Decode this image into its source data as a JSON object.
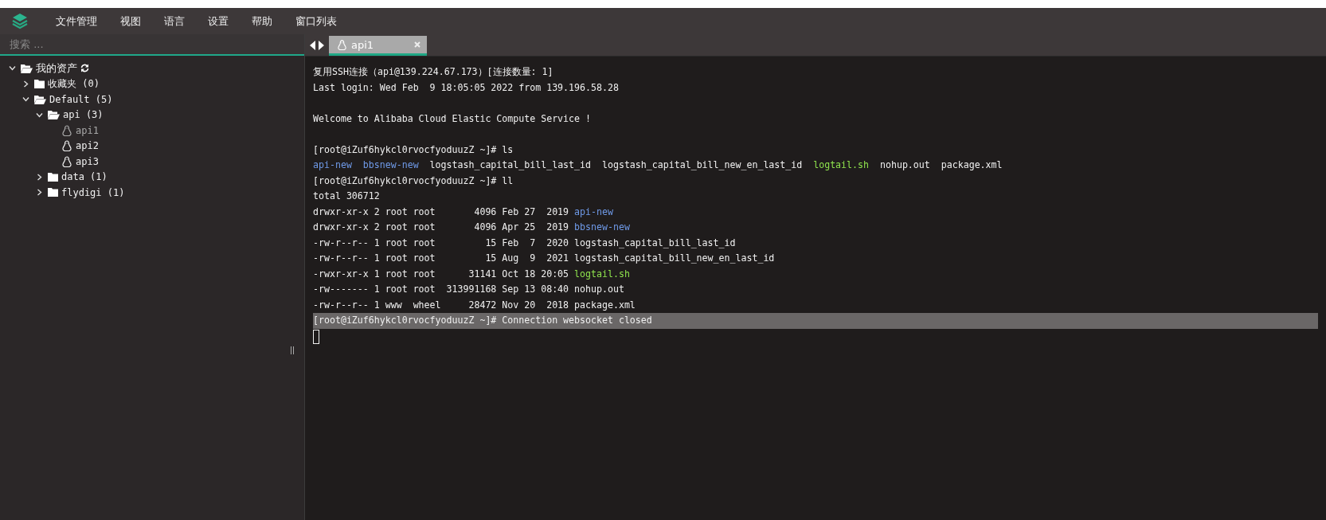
{
  "menu": [
    "文件管理",
    "视图",
    "语言",
    "设置",
    "帮助",
    "窗口列表"
  ],
  "search": {
    "placeholder": "搜索 ..."
  },
  "tree": {
    "label": "我的资产",
    "expanded": true,
    "children": [
      {
        "label": "收藏夹 (0)",
        "kind": "folder",
        "expanded": false
      },
      {
        "label": "Default (5)",
        "kind": "folder",
        "expanded": true,
        "children": [
          {
            "label": "api (3)",
            "kind": "folder",
            "expanded": true,
            "children": [
              {
                "label": "api1",
                "kind": "host",
                "selected": true
              },
              {
                "label": "api2",
                "kind": "host",
                "selected": false
              },
              {
                "label": "api3",
                "kind": "host",
                "selected": false
              }
            ]
          },
          {
            "label": "data (1)",
            "kind": "folder",
            "expanded": false
          },
          {
            "label": "flydigi (1)",
            "kind": "folder",
            "expanded": false
          }
        ]
      }
    ]
  },
  "tabs": [
    {
      "label": "api1",
      "selected": true
    }
  ],
  "terminal": {
    "lines": [
      {
        "kind": "text",
        "highlighted": false,
        "segments": [
          {
            "kind": "plain",
            "text": "复用SSH连接（api@139.224.67.173）[连接数量: 1]"
          }
        ]
      },
      {
        "kind": "text",
        "highlighted": false,
        "segments": [
          {
            "kind": "plain",
            "text": "Last login: Wed Feb  9 18:05:05 2022 from 139.196.58.28"
          }
        ]
      },
      {
        "kind": "blank",
        "highlighted": false
      },
      {
        "kind": "text",
        "highlighted": false,
        "segments": [
          {
            "kind": "plain",
            "text": "Welcome to Alibaba Cloud Elastic Compute Service !"
          }
        ]
      },
      {
        "kind": "blank",
        "highlighted": false
      },
      {
        "kind": "text",
        "highlighted": false,
        "segments": [
          {
            "kind": "plain",
            "text": "[root@iZuf6hykcl0rvocfyoduuzZ ~]# ls"
          }
        ]
      },
      {
        "kind": "listing",
        "highlighted": false,
        "segments": [
          {
            "kind": "dir",
            "text": "api-new"
          },
          {
            "kind": "dir",
            "text": "bbsnew-new"
          },
          {
            "kind": "plain",
            "text": "logstash_capital_bill_last_id"
          },
          {
            "kind": "plain",
            "text": "logstash_capital_bill_new_en_last_id"
          },
          {
            "kind": "exec",
            "text": "logtail.sh"
          },
          {
            "kind": "plain",
            "text": "nohup.out"
          },
          {
            "kind": "plain",
            "text": "package.xml"
          }
        ]
      },
      {
        "kind": "text",
        "highlighted": false,
        "segments": [
          {
            "kind": "plain",
            "text": "[root@iZuf6hykcl0rvocfyoduuzZ ~]# ll"
          }
        ]
      },
      {
        "kind": "text",
        "highlighted": false,
        "segments": [
          {
            "kind": "plain",
            "text": "total 306712"
          }
        ]
      },
      {
        "kind": "text",
        "highlighted": false,
        "segments": [
          {
            "kind": "plain",
            "text": "drwxr-xr-x 2 root root       4096 Feb 27  2019"
          },
          {
            "kind": "dir",
            "text": "api-new"
          }
        ]
      },
      {
        "kind": "text",
        "highlighted": false,
        "segments": [
          {
            "kind": "plain",
            "text": "drwxr-xr-x 2 root root       4096 Apr 25  2019"
          },
          {
            "kind": "dir",
            "text": "bbsnew-new"
          }
        ]
      },
      {
        "kind": "text",
        "highlighted": false,
        "segments": [
          {
            "kind": "plain",
            "text": "-rw-r--r-- 1 root root         15 Feb  7  2020 logstash_capital_bill_last_id"
          }
        ]
      },
      {
        "kind": "text",
        "highlighted": false,
        "segments": [
          {
            "kind": "plain",
            "text": "-rw-r--r-- 1 root root         15 Aug  9  2021 logstash_capital_bill_new_en_last_id"
          }
        ]
      },
      {
        "kind": "text",
        "highlighted": false,
        "segments": [
          {
            "kind": "plain",
            "text": "-rwxr-xr-x 1 root root      31141 Oct 18 20:05"
          },
          {
            "kind": "exec",
            "text": "logtail.sh"
          }
        ]
      },
      {
        "kind": "text",
        "highlighted": false,
        "segments": [
          {
            "kind": "plain",
            "text": "-rw------- 1 root root  313991168 Sep 13 08:40 nohup.out"
          }
        ]
      },
      {
        "kind": "text",
        "highlighted": false,
        "segments": [
          {
            "kind": "plain",
            "text": "-rw-r--r-- 1 www  wheel     28472 Nov 20  2018 package.xml"
          }
        ]
      },
      {
        "kind": "text",
        "highlighted": true,
        "segments": [
          {
            "kind": "plain",
            "text": "[root@iZuf6hykcl0rvocfyoduuzZ ~]# Connection websocket closed"
          }
        ]
      },
      {
        "kind": "cursor",
        "highlighted": false
      }
    ]
  }
}
